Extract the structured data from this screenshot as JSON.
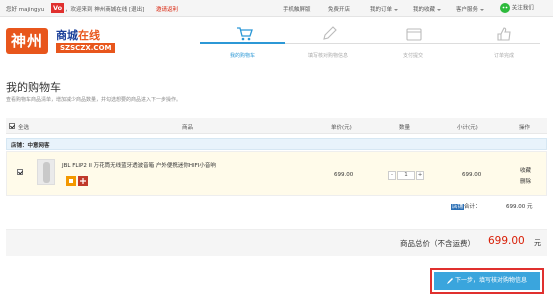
{
  "topbar": {
    "greeting": "您好 majingyu",
    "vo_badge": "Vo",
    "welcome": "，欢迎来到 神州商城在线 [退出]",
    "invite": "邀请返利",
    "links": [
      "手机触屏版",
      "免费开店",
      "我的订单",
      "我的收藏",
      "客户服务",
      "关注我们"
    ]
  },
  "logo": {
    "cn": "神州",
    "name_blue": "商城",
    "name_orange": "在线",
    "domain": "SZSCZX.COM"
  },
  "steps": [
    "我的购物车",
    "填写核对购物信息",
    "支付提交",
    "订单完成"
  ],
  "page": {
    "title": "我的购物车",
    "subtitle": "查看购物车商品清单，增加减少商品数量，并勾选想要的商品进入下一步操作。"
  },
  "table_header": {
    "select_all": "全选",
    "product": "商品",
    "unit_price": "单价(元)",
    "quantity": "数量",
    "subtotal": "小计(元)",
    "actions": "操作"
  },
  "shop": {
    "name": "店铺：中意网客"
  },
  "item": {
    "name": "JBL FLIP2 II 万花筒无线蓝牙透波音箱 户外便携迷你HIFI小音响",
    "price": "699.00",
    "quantity": "1",
    "minus": "-",
    "plus": "+",
    "subtotal": "699.00",
    "favorite": "收藏",
    "delete": "删除"
  },
  "shop_subtotal": {
    "prefix": "店铺",
    "label": "合计：",
    "value": "699.00",
    "unit": "元"
  },
  "grand_total": {
    "label": "商品总价（不含运费）",
    "value": "699.00",
    "unit": "元"
  },
  "next_button": {
    "label": "下一步，填写核对购物信息"
  },
  "colors": {
    "accent_blue": "#2c98d6",
    "button_blue": "#3aa5dd",
    "highlight_red": "#e0302e",
    "price_red": "#d81e06"
  }
}
